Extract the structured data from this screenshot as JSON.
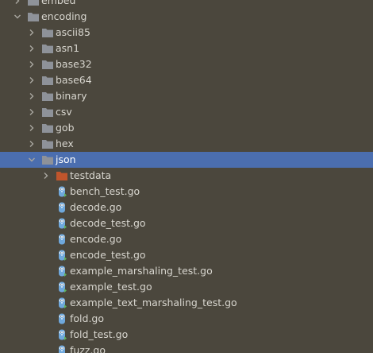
{
  "project_tree": {
    "colors": {
      "background": "#4b473d",
      "selection": "#4b6eaf",
      "folder": "#8e9299",
      "folder_special": "#c0552c",
      "gopher": "#6fa8dc"
    },
    "rows": [
      {
        "label": "embed",
        "type": "folder",
        "state": "collapsed",
        "depth": 0
      },
      {
        "label": "encoding",
        "type": "folder",
        "state": "expanded",
        "depth": 0
      },
      {
        "label": "ascii85",
        "type": "folder",
        "state": "collapsed",
        "depth": 1
      },
      {
        "label": "asn1",
        "type": "folder",
        "state": "collapsed",
        "depth": 1
      },
      {
        "label": "base32",
        "type": "folder",
        "state": "collapsed",
        "depth": 1
      },
      {
        "label": "base64",
        "type": "folder",
        "state": "collapsed",
        "depth": 1
      },
      {
        "label": "binary",
        "type": "folder",
        "state": "collapsed",
        "depth": 1
      },
      {
        "label": "csv",
        "type": "folder",
        "state": "collapsed",
        "depth": 1
      },
      {
        "label": "gob",
        "type": "folder",
        "state": "collapsed",
        "depth": 1
      },
      {
        "label": "hex",
        "type": "folder",
        "state": "collapsed",
        "depth": 1
      },
      {
        "label": "json",
        "type": "folder",
        "state": "expanded",
        "depth": 1,
        "selected": true
      },
      {
        "label": "testdata",
        "type": "testdata-folder",
        "state": "collapsed",
        "depth": 2
      },
      {
        "label": "bench_test.go",
        "type": "go-test-file",
        "depth": 2
      },
      {
        "label": "decode.go",
        "type": "go-file",
        "depth": 2
      },
      {
        "label": "decode_test.go",
        "type": "go-test-file",
        "depth": 2
      },
      {
        "label": "encode.go",
        "type": "go-file",
        "depth": 2
      },
      {
        "label": "encode_test.go",
        "type": "go-test-file",
        "depth": 2
      },
      {
        "label": "example_marshaling_test.go",
        "type": "go-test-file",
        "depth": 2
      },
      {
        "label": "example_test.go",
        "type": "go-test-file",
        "depth": 2
      },
      {
        "label": "example_text_marshaling_test.go",
        "type": "go-test-file",
        "depth": 2
      },
      {
        "label": "fold.go",
        "type": "go-file",
        "depth": 2
      },
      {
        "label": "fold_test.go",
        "type": "go-test-file",
        "depth": 2
      },
      {
        "label": "fuzz.go",
        "type": "go-file",
        "depth": 2
      }
    ]
  }
}
